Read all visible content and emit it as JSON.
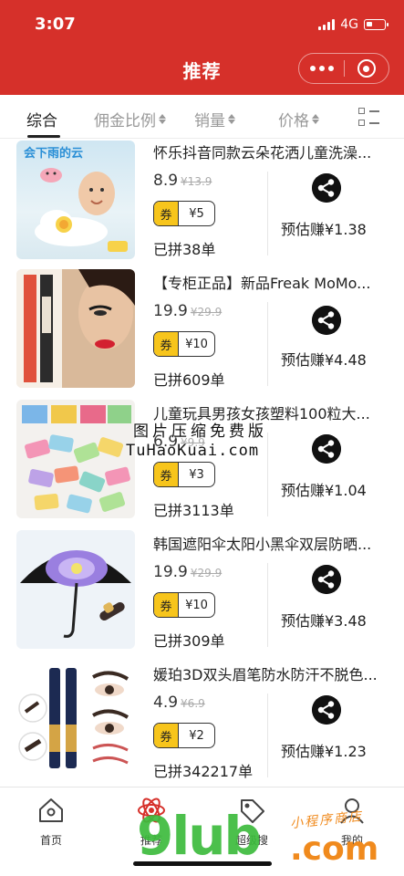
{
  "status_bar": {
    "time": "3:07",
    "network": "4G"
  },
  "header": {
    "title": "推荐"
  },
  "sort_bar": {
    "items": [
      {
        "label": "综合"
      },
      {
        "label": "佣金比例"
      },
      {
        "label": "销量"
      },
      {
        "label": "价格"
      }
    ],
    "active": "综合"
  },
  "products": [
    {
      "title": "怀乐抖音同款云朵花洒儿童洗澡...",
      "price": "8.9",
      "orig_price": "¥13.9",
      "coupon_tag": "券",
      "coupon": "¥5",
      "sold": "已拼38单",
      "earn": "预估赚¥1.38",
      "image_text": "会下雨的云"
    },
    {
      "title": "【专柜正品】新品Freak MoMo...",
      "price": "19.9",
      "orig_price": "¥29.9",
      "coupon_tag": "券",
      "coupon": "¥10",
      "sold": "已拼609单",
      "earn": "预估赚¥4.48"
    },
    {
      "title": "儿童玩具男孩女孩塑料100粒大...",
      "price": "6.9",
      "orig_price": "¥9.9",
      "coupon_tag": "券",
      "coupon": "¥3",
      "sold": "已拼3113单",
      "earn": "预估赚¥1.04"
    },
    {
      "title": "韩国遮阳伞太阳小黑伞双层防晒...",
      "price": "19.9",
      "orig_price": "¥29.9",
      "coupon_tag": "券",
      "coupon": "¥10",
      "sold": "已拼309单",
      "earn": "预估赚¥3.48"
    },
    {
      "title": "媛珀3D双头眉笔防水防汗不脱色...",
      "price": "4.9",
      "orig_price": "¥6.9",
      "coupon_tag": "券",
      "coupon": "¥2",
      "sold": "已拼342217单",
      "earn": "预估赚¥1.23"
    }
  ],
  "watermark": {
    "line1": "图片压缩免费版",
    "line2": "TuHaoKuai.com"
  },
  "tab_bar": {
    "items": [
      {
        "label": "首页"
      },
      {
        "label": "推荐"
      },
      {
        "label": "超级搜"
      },
      {
        "label": "我的"
      }
    ]
  },
  "brand_watermark": {
    "logo": "9lub",
    "domain": ".com",
    "tagline": "小程序商店"
  },
  "colors": {
    "header_bg": "#d6302a",
    "coupon_yellow": "#f7c51c",
    "active_tab": "#222222"
  }
}
